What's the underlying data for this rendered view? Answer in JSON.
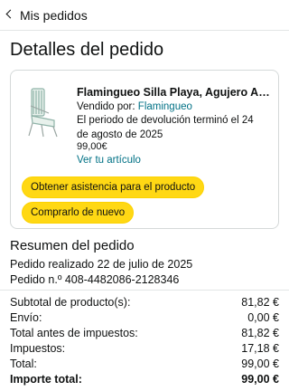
{
  "nav": {
    "back_label": "Mis pedidos"
  },
  "page": {
    "title": "Detalles del pedido"
  },
  "product": {
    "title": "Flamingueo Silla Playa, Agujero Aco...",
    "seller_prefix": "Vendido por:",
    "seller_name": "Flamingueo",
    "return_notice": "El periodo de devolución terminó el 24 de agosto de 2025",
    "price": "99,00€",
    "view_link": "Ver tu artículo",
    "image_icon": "beach-chair-image"
  },
  "actions": {
    "get_help": "Obtener asistencia para el producto",
    "buy_again": "Comprarlo de nuevo"
  },
  "summary": {
    "title": "Resumen del pedido",
    "order_date": "Pedido realizado 22 de julio de 2025",
    "order_number": "Pedido n.º 408-4482086-2128346",
    "rows": [
      {
        "label": "Subtotal de producto(s):",
        "value": "81,82 €"
      },
      {
        "label": "Envío:",
        "value": "0,00 €"
      },
      {
        "label": "Total antes de impuestos:",
        "value": "81,82 €"
      },
      {
        "label": "Impuestos:",
        "value": "17,18 €"
      },
      {
        "label": "Total:",
        "value": "99,00 €"
      },
      {
        "label": "Importe total:",
        "value": "99,00 €"
      }
    ]
  },
  "colors": {
    "button_yellow": "#ffd814",
    "link_teal": "#007185",
    "text": "#0f1111",
    "border": "#d5d9d9"
  }
}
